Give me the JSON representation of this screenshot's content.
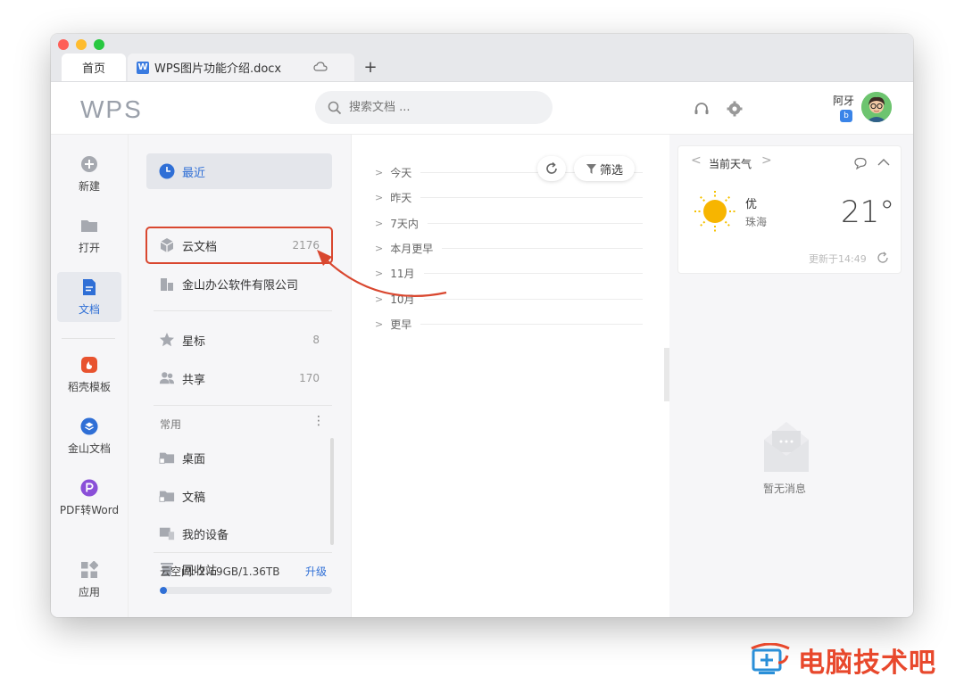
{
  "tabs": {
    "home": "首页",
    "document": "WPS图片功能介绍.docx",
    "add": "+"
  },
  "header": {
    "logo": "WPS",
    "search_placeholder": "搜索文档 ...",
    "username": "阿牙",
    "vip_badge": "b"
  },
  "leftnav": [
    {
      "label": "新建",
      "icon": "plus-circle-icon"
    },
    {
      "label": "打开",
      "icon": "folder-icon"
    },
    {
      "label": "文档",
      "icon": "document-icon"
    },
    {
      "label": "稻壳模板",
      "icon": "docer-icon"
    },
    {
      "label": "金山文档",
      "icon": "kdocs-icon"
    },
    {
      "label": "PDF转Word",
      "icon": "pdf-icon"
    },
    {
      "label": "应用",
      "icon": "apps-icon"
    }
  ],
  "categories": {
    "recent": "最近",
    "cloud_docs": {
      "label": "云文档",
      "count": "2176"
    },
    "company": "金山办公软件有限公司",
    "starred": {
      "label": "星标",
      "count": "8"
    },
    "shared": {
      "label": "共享",
      "count": "170"
    },
    "common_label": "常用",
    "more": "⋮",
    "desktop": "桌面",
    "manuscripts": "文稿",
    "my_devices": "我的设备",
    "trash": "回收站",
    "storage_text": "云空间: 2.19GB/1.36TB",
    "upgrade": "升级",
    "storage_used_fraction": 0.0016
  },
  "timelist": {
    "groups": [
      "今天",
      "昨天",
      "7天内",
      "本月更早",
      "11月",
      "10月",
      "更早"
    ],
    "filter": "筛选"
  },
  "weather": {
    "title": "当前天气",
    "quality": "优",
    "city": "珠海",
    "temperature": "21°",
    "updated": "更新于14:49"
  },
  "messages": {
    "empty": "暂无消息"
  },
  "watermark": {
    "text": "电脑技术吧"
  },
  "colors": {
    "accent": "#2f6fd6",
    "highlight": "#d9472f"
  }
}
